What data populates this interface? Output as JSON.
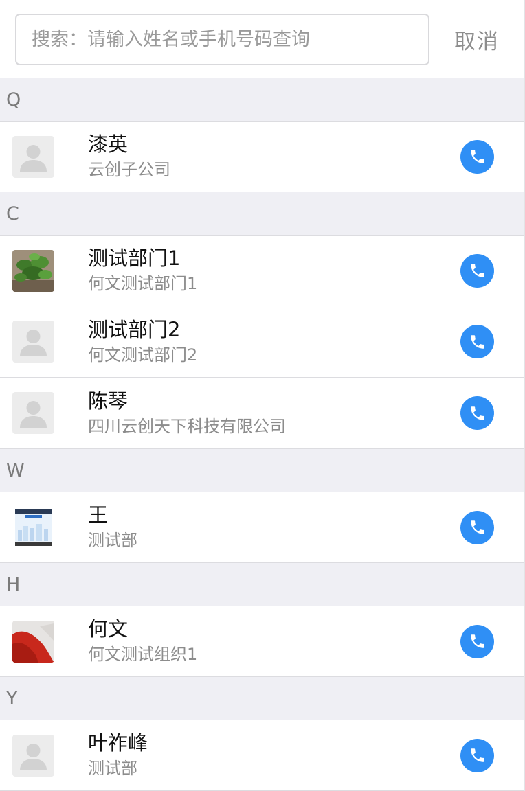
{
  "search": {
    "placeholder": "搜索：请输入姓名或手机号码查询",
    "cancel_label": "取消"
  },
  "colors": {
    "call_button": "#2f8ff5",
    "section_background": "#efeff4"
  },
  "sections": [
    {
      "letter": "Q",
      "contacts": [
        {
          "name": "漆英",
          "org": "云创子公司",
          "avatar": "default-avatar"
        }
      ]
    },
    {
      "letter": "C",
      "contacts": [
        {
          "name": "测试部门1",
          "org": "何文测试部门1",
          "avatar": "plant-photo-avatar"
        },
        {
          "name": "测试部门2",
          "org": "何文测试部门2",
          "avatar": "default-avatar"
        },
        {
          "name": "陈琴",
          "org": "四川云创天下科技有限公司",
          "avatar": "default-avatar"
        }
      ]
    },
    {
      "letter": "W",
      "contacts": [
        {
          "name": "王",
          "org": "测试部",
          "avatar": "screenshot-avatar"
        }
      ]
    },
    {
      "letter": "H",
      "contacts": [
        {
          "name": "何文",
          "org": "何文测试组织1",
          "avatar": "red-photo-avatar"
        }
      ]
    },
    {
      "letter": "Y",
      "contacts": [
        {
          "name": "叶祚峰",
          "org": "测试部",
          "avatar": "default-avatar"
        }
      ]
    }
  ]
}
